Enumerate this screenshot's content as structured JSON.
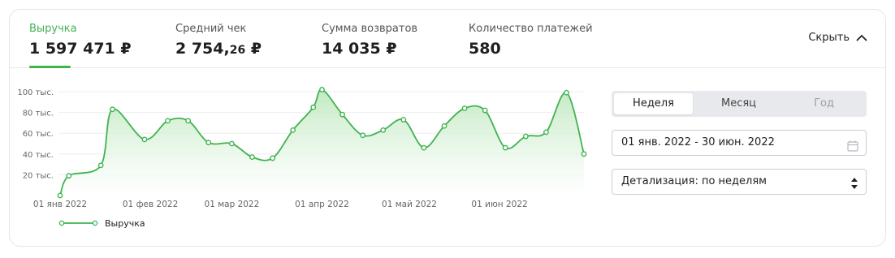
{
  "metrics": [
    {
      "label": "Выручка",
      "value": "1 597 471 ₽",
      "active": true
    },
    {
      "label": "Средний чек",
      "value_int": "2 754,",
      "value_dec": "26",
      "currency": " ₽"
    },
    {
      "label": "Сумма возвратов",
      "value": "14 035 ₽"
    },
    {
      "label": "Количество платежей",
      "value": "580"
    }
  ],
  "hide_label": "Скрыть",
  "period_tabs": [
    {
      "label": "Неделя",
      "active": true
    },
    {
      "label": "Месяц"
    },
    {
      "label": "Год",
      "disabled": true
    }
  ],
  "date_range": "01 янв. 2022 - 30 июн. 2022",
  "detail_select": "Детализация: по неделям",
  "colors": {
    "accent": "#3fb34f",
    "fill": "#d3f0d3"
  },
  "chart_data": {
    "type": "area",
    "x": [
      "2022-01-01",
      "2022-01-04",
      "2022-01-15",
      "2022-01-19",
      "2022-01-30",
      "2022-02-07",
      "2022-02-14",
      "2022-02-21",
      "2022-03-01",
      "2022-03-08",
      "2022-03-15",
      "2022-03-22",
      "2022-03-29",
      "2022-04-01",
      "2022-04-08",
      "2022-04-15",
      "2022-04-22",
      "2022-04-29",
      "2022-05-06",
      "2022-05-13",
      "2022-05-20",
      "2022-05-27",
      "2022-06-03",
      "2022-06-10",
      "2022-06-17",
      "2022-06-24",
      "2022-06-30"
    ],
    "series": [
      {
        "name": "Выручка",
        "values": [
          0,
          19,
          29,
          83,
          54,
          72,
          72,
          51,
          50,
          37,
          36,
          63,
          85,
          102,
          78,
          58,
          63,
          73,
          46,
          67,
          84,
          82,
          46,
          57,
          61,
          99,
          40
        ]
      }
    ],
    "y_ticks": [
      "20 тыс.",
      "40 тыс.",
      "60 тыс.",
      "80 тыс.",
      "100 тыс."
    ],
    "x_ticks": [
      "01 янв 2022",
      "01 фев 2022",
      "01 мар 2022",
      "01 апр 2022",
      "01 май 2022",
      "01 июн 2022"
    ],
    "ylim": [
      0,
      100
    ],
    "grid": true,
    "legend": "bottom-left"
  }
}
